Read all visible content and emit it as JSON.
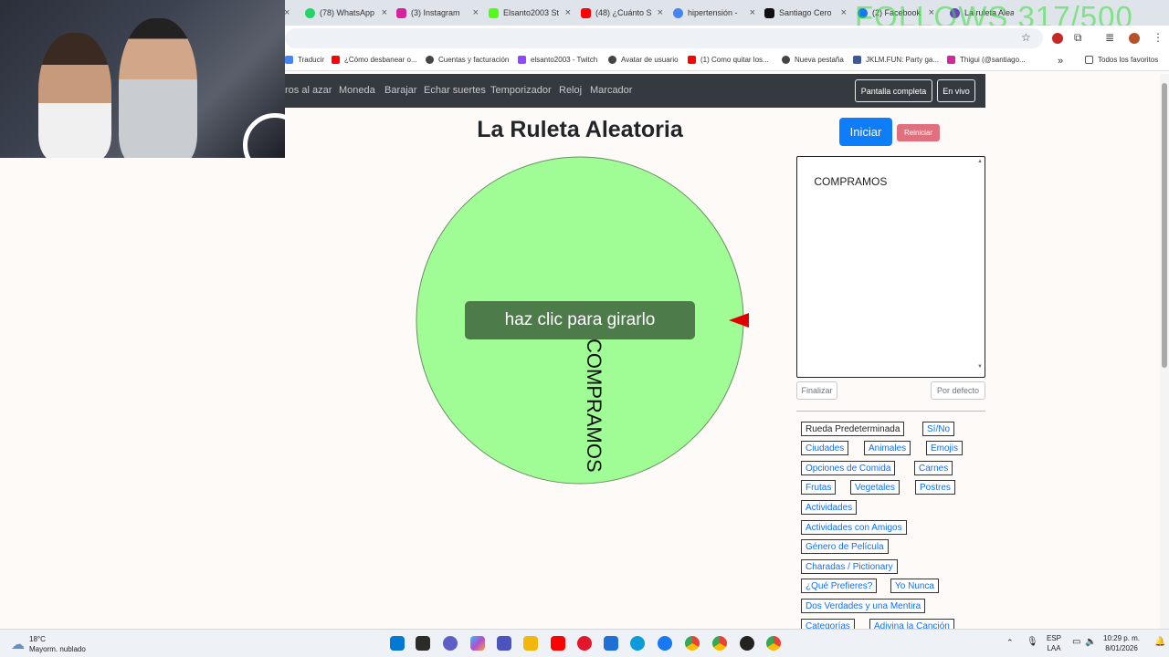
{
  "tabs": [
    {
      "title": "(78) WhatsApp",
      "color": "#25d366"
    },
    {
      "title": "(3) Instagram",
      "color": "#d6249f"
    },
    {
      "title": "Elsanto2003 St",
      "color": "#53fc18"
    },
    {
      "title": "(48) ¿Cuánto S",
      "color": "#ff0000"
    },
    {
      "title": "hipertensión -",
      "color": "#4285f4"
    },
    {
      "title": "Santiago Cero",
      "color": "#111111"
    },
    {
      "title": "(2) Facebook",
      "color": "#1877f2"
    },
    {
      "title": "La ruleta Aleat",
      "color": "#6f42c1"
    }
  ],
  "stream_overlay": "FOLLOWS 317/500",
  "bookmarks": [
    {
      "label": "Traducir",
      "color": "#4285f4"
    },
    {
      "label": "¿Cómo desbanear o...",
      "color": "#ff0000"
    },
    {
      "label": "Cuentas y facturación",
      "color": "#444444"
    },
    {
      "label": "elsanto2003 - Twitch",
      "color": "#9146ff"
    },
    {
      "label": "Avatar de usuario",
      "color": "#444444"
    },
    {
      "label": "(1) Como quitar los...",
      "color": "#ff0000"
    },
    {
      "label": "Nueva pestaña",
      "color": "#444444"
    },
    {
      "label": "JKLM.FUN: Party ga...",
      "color": "#3b5998"
    },
    {
      "label": "Thigui (@santiago...",
      "color": "#d6249f"
    }
  ],
  "bookmarks_all": "Todos los favoritos",
  "nav": {
    "links": [
      "ros al azar",
      "Moneda",
      "Barajar",
      "Echar suertes",
      "Temporizador",
      "Reloj",
      "Marcador"
    ],
    "fullscreen_btn": "Pantalla completa",
    "live_btn": "En vivo"
  },
  "page": {
    "title": "La Ruleta Aleatoria",
    "start_btn": "Iniciar",
    "reset_btn": "Reiniciar",
    "spin_prompt": "haz clic para girarlo",
    "wheel_segment": "COMPRAMOS",
    "wheel_color": "#a0fc95",
    "pointer_color": "#e00000",
    "entries_text": "COMPRAMOS",
    "finish_btn": "Finalizar",
    "default_btn": "Por defecto"
  },
  "presets": [
    "Rueda Predeterminada",
    "Sí/No",
    "Ciudades",
    "Animales",
    "Emojis",
    "Opciones de Comida",
    "Carnes",
    "Frutas",
    "Vegetales",
    "Postres",
    "Actividades",
    "Actividades con Amigos",
    "Género de Película",
    "Charadas / Pictionary",
    "¿Qué Prefieres?",
    "Yo Nunca",
    "Dos Verdades y una Mentira",
    "Categorías",
    "Adivina la Canción"
  ],
  "taskbar": {
    "temp": "18°C",
    "weather": "Mayorm. nublado",
    "lang1": "ESP",
    "lang2": "LAA",
    "time": "10:29 p. m.",
    "date": "8/01/2026"
  }
}
